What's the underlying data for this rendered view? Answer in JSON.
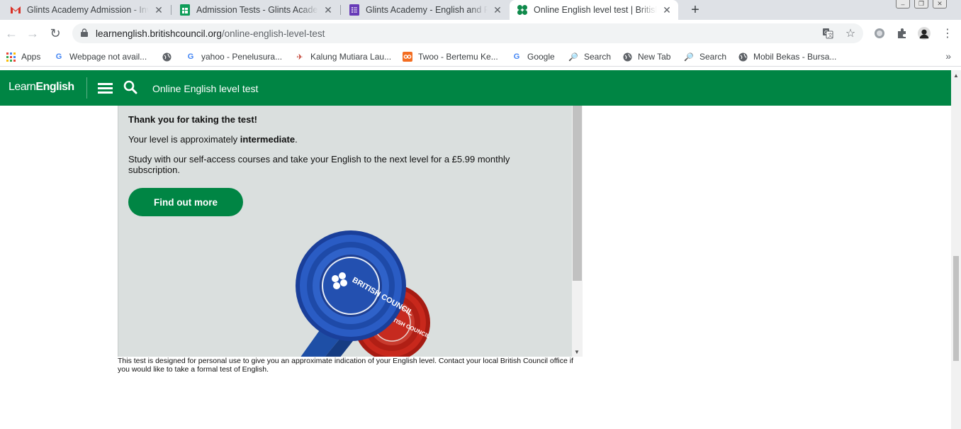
{
  "browser": {
    "tabs": [
      {
        "title": "Glints Academy Admission - Invit",
        "icon": "gmail-icon"
      },
      {
        "title": "Admission Tests - Glints Academy",
        "icon": "sheets-icon"
      },
      {
        "title": "Glints Academy - English and Per",
        "icon": "forms-icon"
      },
      {
        "title": "Online English level test | British C",
        "icon": "learnenglish-icon"
      }
    ],
    "new_tab": "+",
    "url_host": "learnenglish.britishcouncil.org",
    "url_path": "/online-english-level-test"
  },
  "bookmarks": [
    {
      "label": "Apps",
      "icon": "apps-grid-icon"
    },
    {
      "label": "Webpage not avail...",
      "icon": "google-icon"
    },
    {
      "label": "",
      "icon": "globe-icon"
    },
    {
      "label": "yahoo - Penelusura...",
      "icon": "google-icon"
    },
    {
      "label": "Kalung Mutiara Lau...",
      "icon": "pin-icon"
    },
    {
      "label": "Twoo - Bertemu Ke...",
      "icon": "twoo-icon"
    },
    {
      "label": "Google",
      "icon": "google-icon"
    },
    {
      "label": "Search",
      "icon": "search-icon"
    },
    {
      "label": "New Tab",
      "icon": "globe-icon"
    },
    {
      "label": "Search",
      "icon": "search-icon"
    },
    {
      "label": "Mobil Bekas - Bursa...",
      "icon": "globe-icon"
    }
  ],
  "site": {
    "logo_light": "Learn",
    "logo_bold": "English",
    "page_title": "Online English level test",
    "brand_green": "#008544"
  },
  "result": {
    "thanks": "Thank you for taking the test!",
    "level_prefix": "Your level is approximately ",
    "level_value": "intermediate",
    "level_suffix": ".",
    "study": "Study with our self-access courses and take your English to the next level for a £5.99 monthly subscription.",
    "button": "Find out more",
    "rosette_big": "BRITISH COUNCIL",
    "rosette_small": "BRITISH COUNCIL"
  },
  "disclaimer": "This test is designed for personal use to give you an approximate indication of your English level. Contact your local British Council office if you would like to take a formal test of English."
}
